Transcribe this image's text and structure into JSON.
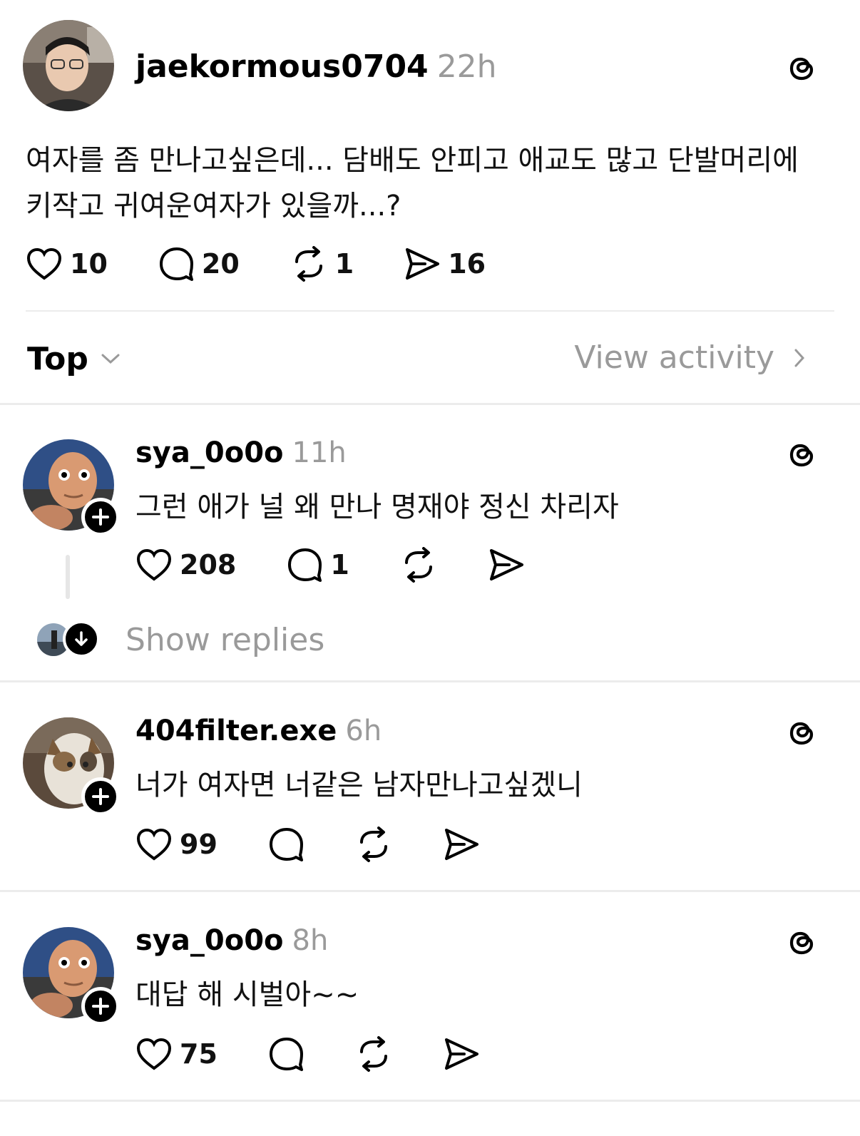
{
  "post": {
    "username": "jaekormous0704",
    "time": "22h",
    "text_line1": "여자를 좀 만나고싶은데... 담배도 안피고 애교도 많고 단발머리에",
    "text_line2": "키작고 귀여운여자가 있을까...?",
    "likes": "10",
    "comments": "20",
    "reposts": "1",
    "shares": "16"
  },
  "sort_bar": {
    "sort_label": "Top",
    "activity_label": "View activity"
  },
  "replies": [
    {
      "username": "sya_0o0o",
      "time": "11h",
      "text": "그런 애가 널 왜 만나 명재야 정신 차리자",
      "likes": "208",
      "comments": "1",
      "show_replies_label": "Show replies"
    },
    {
      "username": "404filter.exe",
      "time": "6h",
      "text": "너가 여자면 너같은 남자만나고싶겠니",
      "likes": "99"
    },
    {
      "username": "sya_0o0o",
      "time": "8h",
      "text": "대답 해 시벌아~~",
      "likes": "75"
    }
  ],
  "icons": {
    "like": "heart-icon",
    "comment": "comment-bubble-icon",
    "repost": "repost-icon",
    "share": "send-icon",
    "brand": "threads-logo-icon",
    "follow": "plus-icon",
    "expand": "arrow-down-icon"
  }
}
